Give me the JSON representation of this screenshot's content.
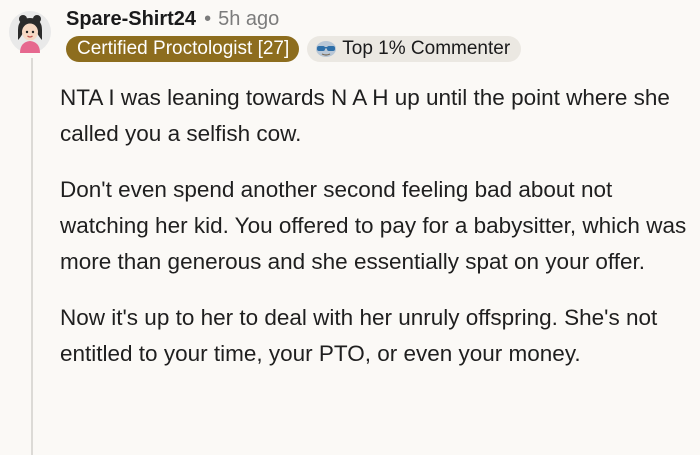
{
  "comment": {
    "username": "Spare-Shirt24",
    "separator": "•",
    "time": "5h ago",
    "flair": "Certified Proctologist [27]",
    "top_badge": "Top 1% Commenter",
    "top_badge_icon": "sunglasses-icon",
    "avatar_icon": "avatar-icon",
    "paragraphs": [
      "NTA I was leaning towards N A H up until the point where she called you a selfish cow.",
      "Don't even spend another second feeling bad about not watching her kid. You offered to pay for a babysitter, which was more than generous and she essentially spat on your offer.",
      "Now it's up to her to deal with her unruly offspring. She's not entitled to your time, your PTO, or even your money."
    ]
  },
  "colors": {
    "background": "#fbf9f6",
    "flair_bg": "#8d6d1e",
    "badge_bg": "#ebe8e2",
    "thread_line": "#dcdad6"
  }
}
